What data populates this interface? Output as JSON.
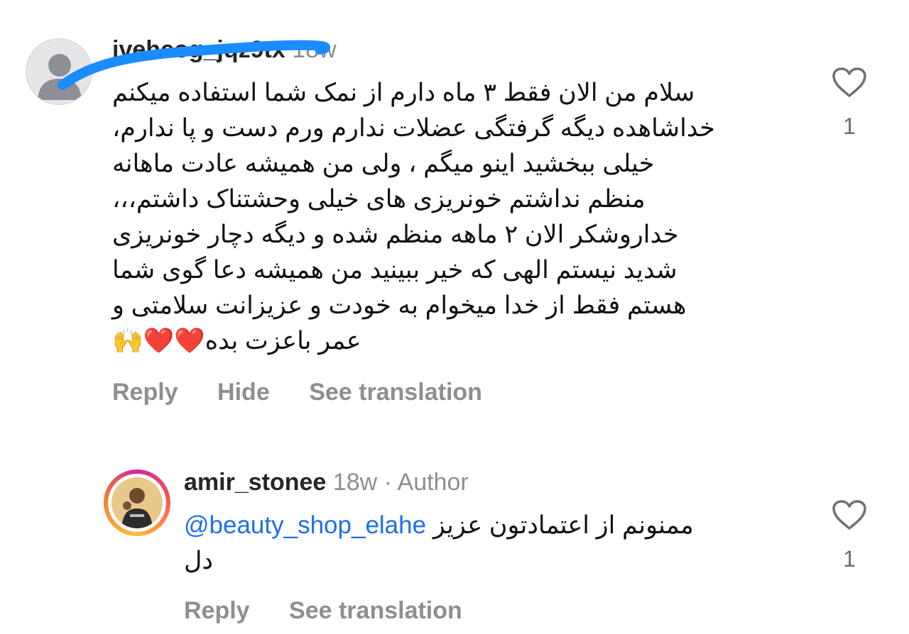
{
  "comments": [
    {
      "username": "ivehcog_jqz9tx",
      "time": "18w",
      "lines": [
        "سلام من الان فقط ۳ ماه دارم از نمک شما استفاده میکنم",
        "خداشاهده دیگه گرفتگی عضلات ندارم ورم دست و پا ندارم،",
        "خیلی ببخشید اینو میگم ، ولی من همیشه عادت ماهانه",
        "منظم نداشتم خونریزی های خیلی وحشتناک داشتم،،،",
        "خداروشکر الان ۲ ماهه منظم شده و دیگه دچار خونریزی",
        "شدید نیستم الهی که خیر ببینید من همیشه دعا گوی شما",
        "هستم فقط از خدا میخوام به خودت و عزیزانت سلامتی و",
        "عمر باعزت بده"
      ],
      "emoji": "❤️❤️🙌",
      "actions": {
        "reply": "Reply",
        "hide": "Hide",
        "translate": "See translation"
      },
      "like_count": "1"
    },
    {
      "username": "amir_stonee",
      "time": "18w",
      "separator": "·",
      "badge": "Author",
      "mention": "@beauty_shop_elahe",
      "text_line1": "ممنونم از اعتمادتون عزیز",
      "text_line2": "دل",
      "actions": {
        "reply": "Reply",
        "translate": "See translation"
      },
      "like_count": "1"
    }
  ],
  "colors": {
    "scribble": "#1a8cff",
    "mention": "#1f6feb",
    "muted": "#8e8e93"
  },
  "icons": [
    "default-avatar-icon",
    "heart-outline-icon"
  ]
}
